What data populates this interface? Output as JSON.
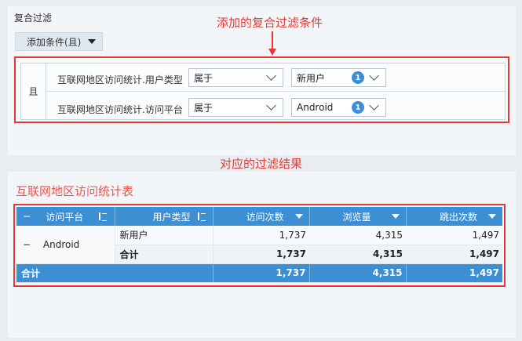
{
  "filter_panel": {
    "title": "复合过滤",
    "add_condition_label": "添加条件(且)",
    "logic_label": "且",
    "conditions": [
      {
        "field": "互联网地区访问统计.用户类型",
        "operator": "属于",
        "value": "新用户",
        "count": "1"
      },
      {
        "field": "互联网地区访问统计.访问平台",
        "operator": "属于",
        "value": "Android",
        "count": "1"
      }
    ]
  },
  "annotations": {
    "top": "添加的复合过滤条件",
    "bottom": "对应的过滤结果"
  },
  "table": {
    "title": "互联网地区访问统计表",
    "headers": {
      "collapse": "−",
      "platform": "访问平台",
      "user_type": "用户类型",
      "visits": "访问次数",
      "pageviews": "浏览量",
      "bounces": "跳出次数"
    },
    "group": {
      "collapse": "−",
      "platform": "Android",
      "rows": [
        {
          "user_type": "新用户",
          "visits": "1,737",
          "pageviews": "4,315",
          "bounces": "1,497"
        }
      ],
      "subtotal": {
        "label": "合计",
        "visits": "1,737",
        "pageviews": "4,315",
        "bounces": "1,497"
      }
    },
    "total": {
      "label": "合计",
      "visits": "1,737",
      "pageviews": "4,315",
      "bounces": "1,497"
    }
  },
  "colors": {
    "accent": "#3d8fd4",
    "annotation": "#e53935"
  }
}
